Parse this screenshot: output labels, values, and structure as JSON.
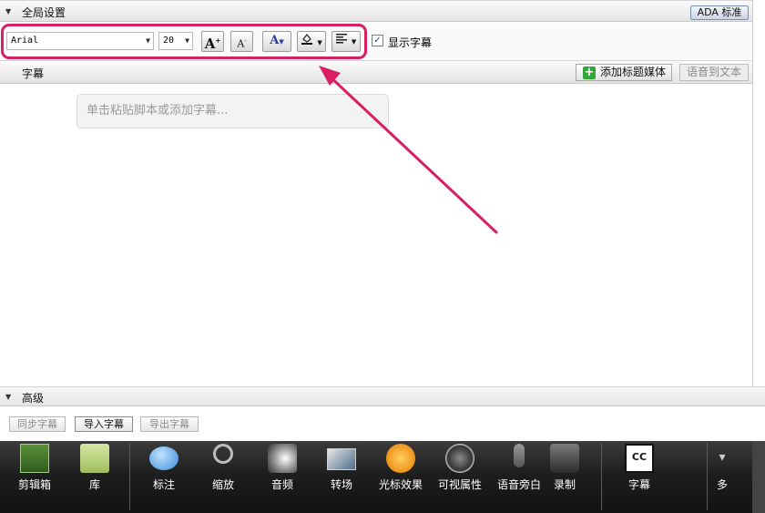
{
  "global_settings": {
    "title": "全局设置",
    "ada_button": "ADA 标准"
  },
  "font_toolbar": {
    "font_family": "Arial",
    "font_size": "20",
    "increase_font": "A",
    "decrease_font": "A",
    "text_color": "A",
    "show_captions_label": "显示字幕",
    "show_captions_checked": true,
    "highlight_color": "#d81f63"
  },
  "captions": {
    "title": "字幕",
    "add_media_button": "添加标题媒体",
    "speech_to_text_button": "语音到文本",
    "input_placeholder": "单击粘贴脚本或添加字幕..."
  },
  "advanced": {
    "title": "高级",
    "sync_button": "同步字幕",
    "import_button": "导入字幕",
    "export_button": "导出字幕"
  },
  "dock": {
    "items": [
      {
        "label": "剪辑箱",
        "icon": "clip-bin-icon"
      },
      {
        "label": "库",
        "icon": "library-icon"
      },
      {
        "label": "标注",
        "icon": "callout-icon"
      },
      {
        "label": "缩放",
        "icon": "zoom-icon"
      },
      {
        "label": "音频",
        "icon": "audio-icon"
      },
      {
        "label": "转场",
        "icon": "transition-icon"
      },
      {
        "label": "光标效果",
        "icon": "cursor-effects-icon"
      },
      {
        "label": "可视属性",
        "icon": "visual-properties-icon"
      },
      {
        "label": "语音旁白",
        "icon": "voice-narration-icon"
      },
      {
        "label": "录制",
        "icon": "record-icon"
      },
      {
        "label": "字幕",
        "icon": "captions-icon"
      },
      {
        "label": "多",
        "icon": "more-icon"
      }
    ]
  }
}
